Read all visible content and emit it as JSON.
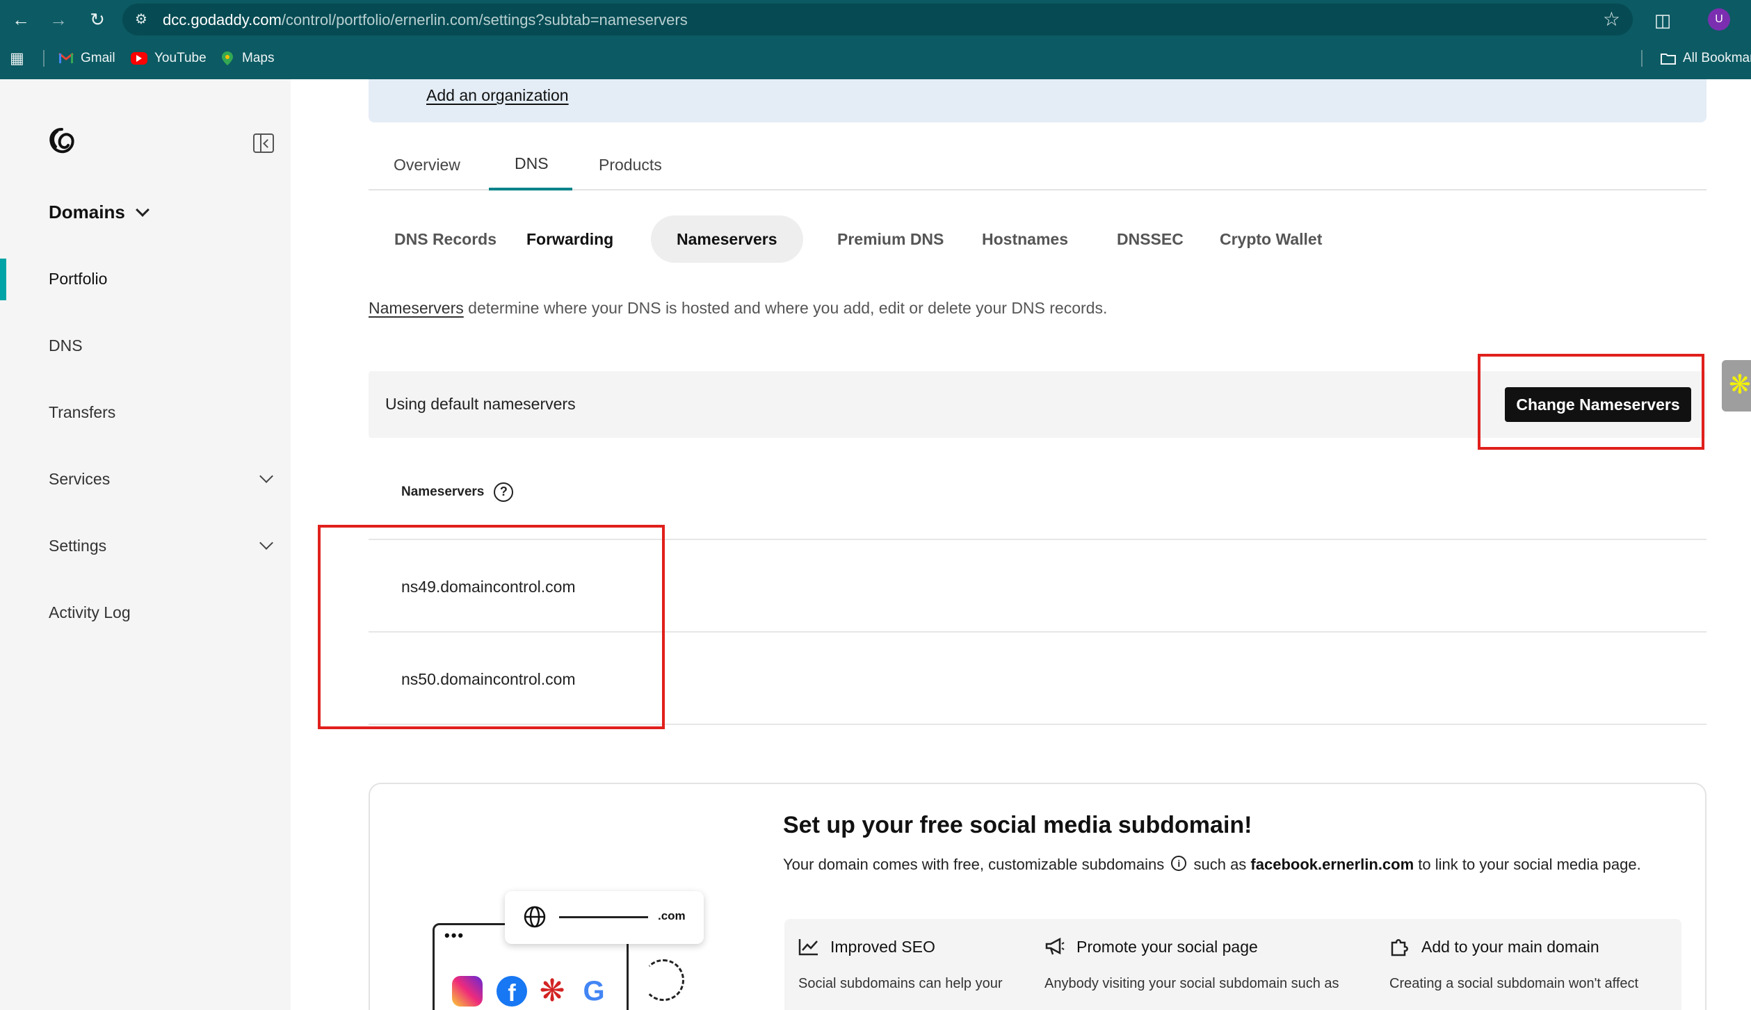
{
  "browser": {
    "url_host": "dcc.godaddy.com",
    "url_path": "/control/portfolio/ernerlin.com/settings?subtab=nameservers",
    "profile_initial": "U",
    "bookmarks": [
      "Gmail",
      "YouTube",
      "Maps"
    ],
    "all_bookmarks": "All Bookmarks"
  },
  "sidebar": {
    "section_title": "Domains",
    "items": [
      {
        "label": "Portfolio",
        "active": true
      },
      {
        "label": "DNS"
      },
      {
        "label": "Transfers"
      },
      {
        "label": "Services",
        "expandable": true
      },
      {
        "label": "Settings",
        "expandable": true
      },
      {
        "label": "Activity Log"
      }
    ]
  },
  "banner": {
    "link": "Add an organization"
  },
  "tabs": [
    "Overview",
    "DNS",
    "Products"
  ],
  "active_tab": "DNS",
  "subtabs": [
    "DNS Records",
    "Forwarding",
    "Nameservers",
    "Premium DNS",
    "Hostnames",
    "DNSSEC",
    "Crypto Wallet"
  ],
  "active_subtab": "Nameservers",
  "description": {
    "link": "Nameservers",
    "text": " determine where your DNS is hosted and where you add, edit or delete your DNS records."
  },
  "nameserver_panel": {
    "status": "Using default nameservers",
    "button": "Change Nameservers",
    "header": "Nameservers",
    "help_glyph": "?",
    "servers": [
      "ns49.domaincontrol.com",
      "ns50.domaincontrol.com"
    ]
  },
  "promo": {
    "title": "Set up your free social media subdomain!",
    "text_before": "Your domain comes with free, customizable subdomains",
    "text_mid": " such as ",
    "example": "facebook.ernerlin.com",
    "text_after": " to link to your social media page.",
    "illustration_url_suffix": ".com",
    "features": [
      {
        "title": "Improved SEO",
        "icon": "chart-line-icon",
        "desc": "Social subdomains can help your"
      },
      {
        "title": "Promote your social page",
        "icon": "megaphone-icon",
        "desc": "Anybody visiting your social subdomain such as"
      },
      {
        "title": "Add to your main domain",
        "icon": "puzzle-icon",
        "desc": "Creating a social subdomain won't affect"
      }
    ]
  },
  "colors": {
    "chrome": "#0c5a63",
    "accent_teal": "#00a4a6",
    "highlight_red": "#e0201c",
    "button_dark": "#111111"
  }
}
